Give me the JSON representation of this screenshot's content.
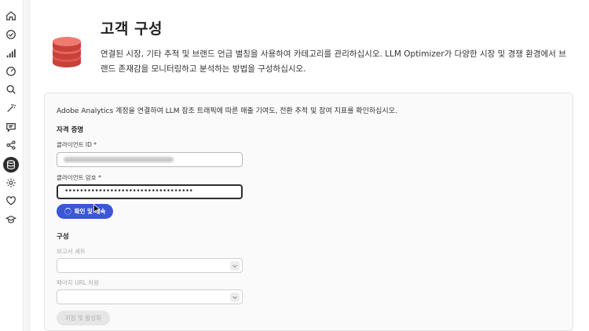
{
  "sidebar": {
    "icons": [
      "home-icon",
      "check-circle-icon",
      "bar-chart-icon",
      "gauge-icon",
      "search-icon",
      "magic-wand-icon",
      "chat-icon",
      "share-icon",
      "database-icon",
      "settings-gear-icon",
      "heart-icon",
      "graduation-cap-icon"
    ],
    "active": "database-icon"
  },
  "header": {
    "title": "고객 구성",
    "description": "연결된 시장, 기타 추적 및 브랜드 언급 별칭을 사용하여 카테고리를 관리하십시오. LLM Optimizer가 다양한 시장 및 경쟁 환경에서 브랜드 존재감을 모니터링하고 분석하는 방법을 구성하십시오.",
    "icon": "database-stack-icon"
  },
  "card": {
    "intro": "Adobe Analytics 계정을 연결하여 LLM 참조 트래픽에 따른 매출 기여도, 전환 추적 및 참여 지표를 확인하십시오.",
    "credentials": {
      "heading": "자격 증명",
      "client_id_label": "클라이언트 ID *",
      "client_secret_label": "클라이언트 암호 *",
      "client_secret_value": "••••••••••••••••••••••••••••••••••",
      "confirm_button": "확인 및 계속"
    },
    "config": {
      "heading": "구성",
      "report_suite_label": "보고서 세트",
      "page_url_label": "페이지 URL 차원",
      "save_button": "저장 및 활성화"
    }
  },
  "colors": {
    "primary": "#3b56d6",
    "accent_tab": "#f1d9b0",
    "icon_red": "#e2574c"
  }
}
